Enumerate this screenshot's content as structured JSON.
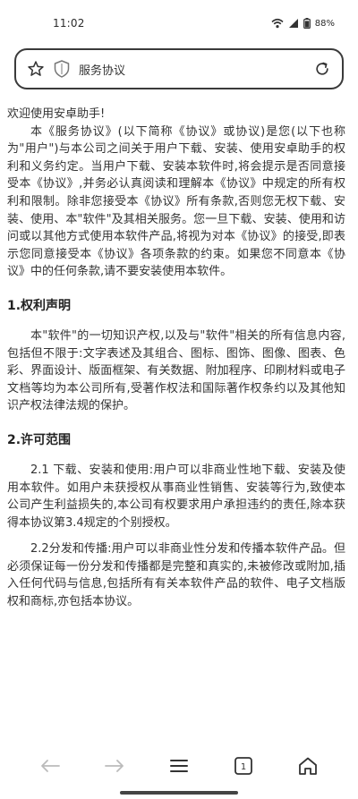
{
  "status_bar": {
    "time": "11:02",
    "battery": "88%"
  },
  "address_bar": {
    "title": "服务协议",
    "icons": [
      "star-icon",
      "shield-icon",
      "reload-icon"
    ]
  },
  "content": {
    "greeting": "欢迎使用安卓助手!",
    "intro": "本《服务协议》(以下简称《协议》或协议)是您(以下也称为\"用户\")与本公司之间关于用户下载、安装、使用安卓助手的权利和义务约定。当用户下载、安装本软件时,将会提示是否同意接受本《协议》,并务必认真阅读和理解本《协议》中规定的所有权利和限制。除非您接受本《协议》所有条款,否则您无权下载、安装、使用、本\"软件\"及其相关服务。您一旦下载、安装、使用和访问或以其他方式使用本软件产品,将视为对本《协议》的接受,即表示您同意接受本《协议》各项条款的约束。如果您不同意本《协议》中的任何条款,请不要安装使用本软件。",
    "section1": {
      "heading": "1.权利声明",
      "body": "本\"软件\"的一切知识产权,以及与\"软件\"相关的所有信息内容,包括但不限于:文字表述及其组合、图标、图饰、图像、图表、色彩、界面设计、版面框架、有关数据、附加程序、印刷材料或电子文档等均为本公司所有,受著作权法和国际著作权条约以及其他知识产权法律法规的保护。"
    },
    "section2": {
      "heading": "2.许可范围",
      "p1": "2.1 下载、安装和使用:用户可以非商业性地下载、安装及使用本软件。如用户未获授权从事商业性销售、安装等行为,致使本公司产生利益损失的,本公司有权要求用户承担违约的责任,除本获得本协议第3.4规定的个别授权。",
      "p2": "2.2分发和传播:用户可以非商业性分发和传播本软件产品。但必须保证每一份分发和传播都是完整和真实的,未被修改或附加,插入任何代码与信息,包括所有有关本软件产品的软件、电子文档版权和商标,亦包括本协议。"
    }
  },
  "bottom_nav": {
    "tab_count": "1",
    "icons": [
      "back-icon",
      "forward-icon",
      "menu-icon",
      "tabs-icon",
      "home-icon"
    ]
  }
}
